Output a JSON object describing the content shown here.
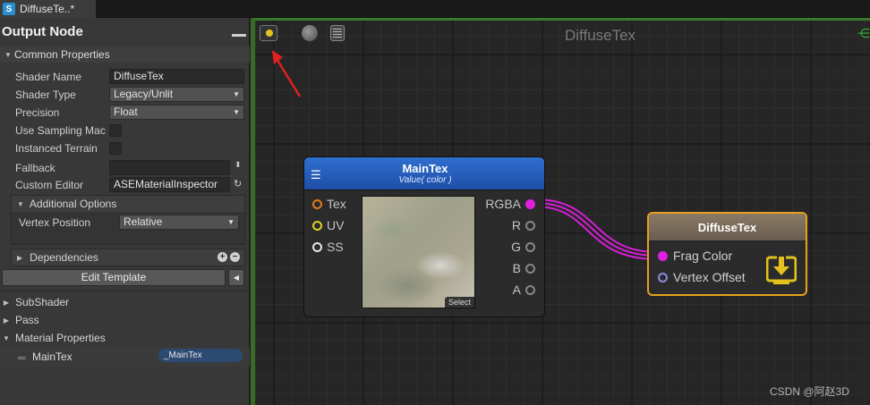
{
  "tab": {
    "title": "DiffuseTe..*",
    "icon": "shader-icon"
  },
  "panel": {
    "title": "Output Node",
    "common_header": "Common Properties",
    "fields": {
      "shader_name_label": "Shader Name",
      "shader_name_value": "DiffuseTex",
      "shader_type_label": "Shader Type",
      "shader_type_value": "Legacy/Unlit",
      "precision_label": "Precision",
      "precision_value": "Float",
      "use_sampling_label": "Use Sampling Mac",
      "instanced_terrain_label": "Instanced Terrain",
      "fallback_label": "Fallback",
      "fallback_value": "",
      "custom_editor_label": "Custom Editor",
      "custom_editor_value": "ASEMaterialInspector"
    },
    "additional_header": "Additional Options",
    "vertex_position_label": "Vertex Position",
    "vertex_position_value": "Relative",
    "dependencies_label": "Dependencies",
    "edit_template_label": "Edit Template",
    "subshader_label": "SubShader",
    "pass_label": "Pass",
    "material_properties_label": "Material Properties",
    "property_name": "MainTex",
    "property_ref": "_MainTex"
  },
  "canvas": {
    "title": "DiffuseTex",
    "watermark": "CSDN @阿赵3D"
  },
  "maintex_node": {
    "title": "MainTex",
    "subtitle": "Value( color )",
    "inputs": [
      {
        "label": "Tex",
        "color": "#e07a1f"
      },
      {
        "label": "UV",
        "color": "#e0d01f"
      },
      {
        "label": "SS",
        "color": "#e6e6e6"
      }
    ],
    "outputs": [
      {
        "label": "RGBA",
        "color": "#e020e0"
      },
      {
        "label": "R",
        "color": "#888888"
      },
      {
        "label": "G",
        "color": "#888888"
      },
      {
        "label": "B",
        "color": "#888888"
      },
      {
        "label": "A",
        "color": "#888888"
      }
    ],
    "select_label": "Select"
  },
  "output_node": {
    "title": "DiffuseTex",
    "inputs": [
      {
        "label": "Frag Color",
        "color": "#e020e0"
      },
      {
        "label": "Vertex Offset",
        "color": "#8a8ae0"
      }
    ]
  }
}
